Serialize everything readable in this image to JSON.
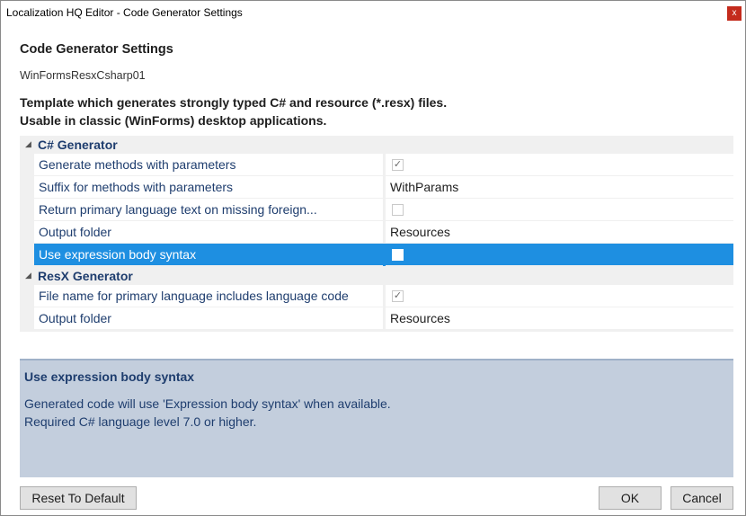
{
  "window": {
    "title": "Localization HQ Editor - Code Generator Settings",
    "close_glyph": "x"
  },
  "heading": "Code Generator Settings",
  "template_name": "WinFormsResxCsharp01",
  "description": {
    "line1": "Template which generates strongly typed C# and resource (*.resx) files.",
    "line2": "Usable in classic (WinForms) desktop applications."
  },
  "grid": {
    "categories": [
      {
        "label": "C# Generator",
        "toggle": "◢",
        "properties": [
          {
            "name": "Generate methods with parameters",
            "type": "checkbox",
            "checked": true
          },
          {
            "name": "Suffix for methods with parameters",
            "type": "text",
            "value": "WithParams"
          },
          {
            "name": "Return primary language text on missing foreign...",
            "type": "checkbox",
            "checked": false
          },
          {
            "name": "Output folder",
            "type": "text",
            "value": "Resources"
          },
          {
            "name": "Use expression body syntax",
            "type": "checkbox",
            "checked": false,
            "selected": true
          }
        ]
      },
      {
        "label": "ResX Generator",
        "toggle": "◢",
        "properties": [
          {
            "name": "File name for primary language includes language code",
            "type": "checkbox",
            "checked": true
          },
          {
            "name": "Output folder",
            "type": "text",
            "value": "Resources"
          }
        ]
      }
    ],
    "check_glyph": "✓"
  },
  "help": {
    "title": "Use expression body syntax",
    "line1": "Generated code will use 'Expression body syntax' when available.",
    "line2": "Required C# language level 7.0 or higher."
  },
  "buttons": {
    "reset": "Reset To Default",
    "ok": "OK",
    "cancel": "Cancel"
  },
  "colors": {
    "selection": "#1e8fe1",
    "help_background": "#c3cedd",
    "label_text": "#1e3d6e",
    "close": "#c42b1c"
  }
}
